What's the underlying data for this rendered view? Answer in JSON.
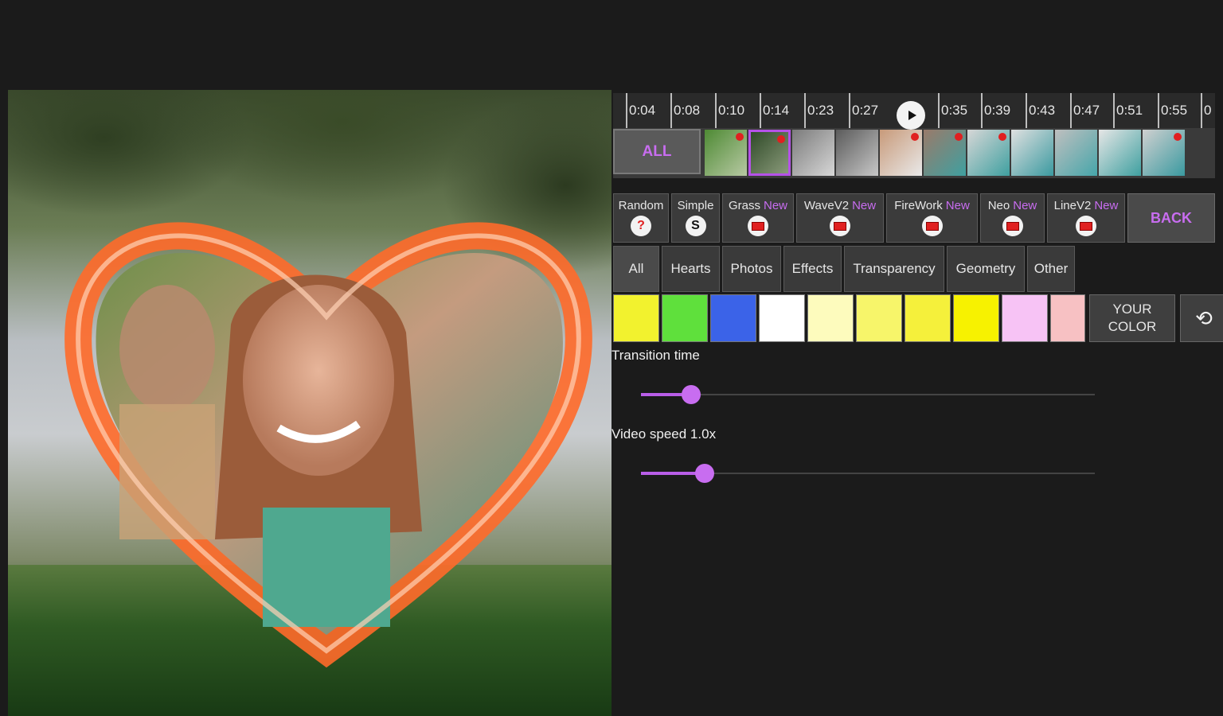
{
  "timeline": {
    "ticks": [
      "0:04",
      "0:08",
      "0:10",
      "0:14",
      "0:23",
      "0:27",
      "0:35",
      "0:39",
      "0:43",
      "0:47",
      "0:51",
      "0:55",
      "0"
    ],
    "all_label": "ALL",
    "selected_thumb_index": 1
  },
  "transitions": {
    "items": [
      {
        "label": "Random",
        "new": "",
        "icon": "question-icon"
      },
      {
        "label": "Simple",
        "new": "",
        "icon": "s-icon"
      },
      {
        "label": "Grass",
        "new": "New",
        "icon": "stop-icon"
      },
      {
        "label": "WaveV2",
        "new": "New",
        "icon": "stop-icon"
      },
      {
        "label": "FireWork",
        "new": "New",
        "icon": "stop-icon"
      },
      {
        "label": "Neo",
        "new": "New",
        "icon": "stop-icon"
      },
      {
        "label": "LineV2",
        "new": "New",
        "icon": "stop-icon"
      }
    ],
    "back_label": "BACK"
  },
  "categories": {
    "items": [
      "All",
      "Hearts",
      "Photos",
      "Effects",
      "Transparency",
      "Geometry",
      "Other"
    ],
    "active": "All"
  },
  "colors": {
    "swatches": [
      "#f2f22e",
      "#5fe03c",
      "#3b63e8",
      "#ffffff",
      "#fdfbbd",
      "#f7f56a",
      "#f5f03b",
      "#f7f200",
      "#f7c3f5",
      "#f7c1c3"
    ],
    "your_color_label": "YOUR\nCOLOR",
    "accent": "#c86df0"
  },
  "transition_time": {
    "label": "Transition time",
    "value_fraction": 0.11
  },
  "video_speed": {
    "label": "Video speed 1.0x",
    "value_fraction": 0.14
  }
}
